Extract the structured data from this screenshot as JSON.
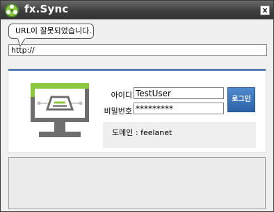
{
  "window": {
    "title": "fx.Sync",
    "close_label": "x"
  },
  "tooltip": {
    "message": "URL이 잘못되었습니다."
  },
  "url": {
    "value": "http://"
  },
  "login": {
    "id_label": "아이디",
    "id_value": "TestUser",
    "password_label": "비밀번호",
    "password_value": "*********",
    "button_label": "로그인",
    "domain_label": "도메인",
    "domain_separator": ":",
    "domain_value": "feelanet"
  },
  "colors": {
    "accent": "#2f5fa8",
    "logo_green": "#8dc63f",
    "monitor_gray": "#6e6e6e"
  },
  "icons": {
    "logo": "fx-sync-logo-icon",
    "monitor": "monitor-sync-icon",
    "close": "close-icon"
  }
}
